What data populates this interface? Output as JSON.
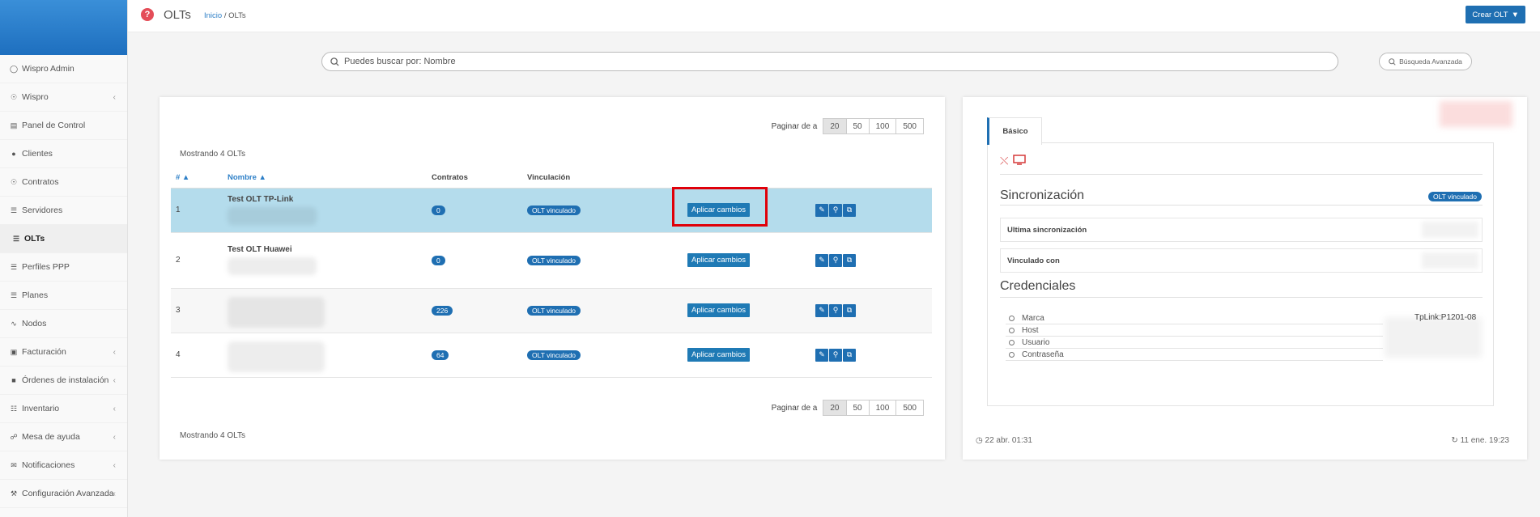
{
  "sidebar": {
    "items": [
      {
        "label": "Wispro Admin",
        "icon": "circle-notch-icon",
        "chev": false
      },
      {
        "label": "Wispro",
        "icon": "eye-icon",
        "chev": true
      },
      {
        "label": "Panel de Control",
        "icon": "chart-area-icon",
        "chev": false
      },
      {
        "label": "Clientes",
        "icon": "users-icon",
        "chev": false
      },
      {
        "label": "Contratos",
        "icon": "eye-icon",
        "chev": false
      },
      {
        "label": "Servidores",
        "icon": "server-icon",
        "chev": false
      },
      {
        "label": "OLTs",
        "icon": "list-icon",
        "chev": false,
        "active": true
      },
      {
        "label": "Perfiles PPP",
        "icon": "list-icon",
        "chev": false
      },
      {
        "label": "Planes",
        "icon": "list-icon",
        "chev": false
      },
      {
        "label": "Nodos",
        "icon": "wifi-icon",
        "chev": false
      },
      {
        "label": "Facturación",
        "icon": "money-icon",
        "chev": true
      },
      {
        "label": "Órdenes de instalación",
        "icon": "truck-icon",
        "chev": true
      },
      {
        "label": "Inventario",
        "icon": "barcode-icon",
        "chev": true
      },
      {
        "label": "Mesa de ayuda",
        "icon": "headset-icon",
        "chev": true
      },
      {
        "label": "Notificaciones",
        "icon": "envelope-icon",
        "chev": true
      },
      {
        "label": "Configuración Avanzada",
        "icon": "wrench-icon",
        "chev": true
      }
    ]
  },
  "header": {
    "title": "OLTs",
    "breadcrumb_home": "Inicio",
    "breadcrumb_sep": " / ",
    "breadcrumb_current": "OLTs",
    "create_label": "Crear OLT"
  },
  "search": {
    "placeholder": "Puedes buscar por: Nombre",
    "advanced_label": "Búsqueda Avanzada"
  },
  "pagination": {
    "label": "Paginar de a",
    "options": [
      "20",
      "50",
      "100",
      "500"
    ],
    "selected": "20"
  },
  "showing_text": "Mostrando 4 OLTs",
  "table": {
    "headers": {
      "num": "# ▲",
      "name": "Nombre ▲",
      "contracts": "Contratos",
      "link": "Vinculación"
    },
    "apply_label": "Aplicar cambios",
    "rows": [
      {
        "num": "1",
        "name": "Test OLT TP-Link",
        "contracts": "0",
        "link": "OLT vinculado"
      },
      {
        "num": "2",
        "name": "Test OLT Huawei",
        "contracts": "0",
        "link": "OLT vinculado"
      },
      {
        "num": "3",
        "name": "",
        "contracts": "226",
        "link": "OLT vinculado"
      },
      {
        "num": "4",
        "name": "",
        "contracts": "64",
        "link": "OLT vinculado"
      }
    ]
  },
  "detail": {
    "tab_label": "Básico",
    "sync_title": "Sincronización",
    "sync_badge": "OLT vinculado",
    "last_sync_label": "Ultima sincronización",
    "linked_with_label": "Vinculado con",
    "cred_title": "Credenciales",
    "cred_labels": [
      "Marca",
      "Host",
      "Usuario",
      "Contraseña"
    ],
    "brand_value": "TpLink:P1201-08",
    "created": "22 abr. 01:31",
    "updated": "11 ene. 19:23"
  }
}
